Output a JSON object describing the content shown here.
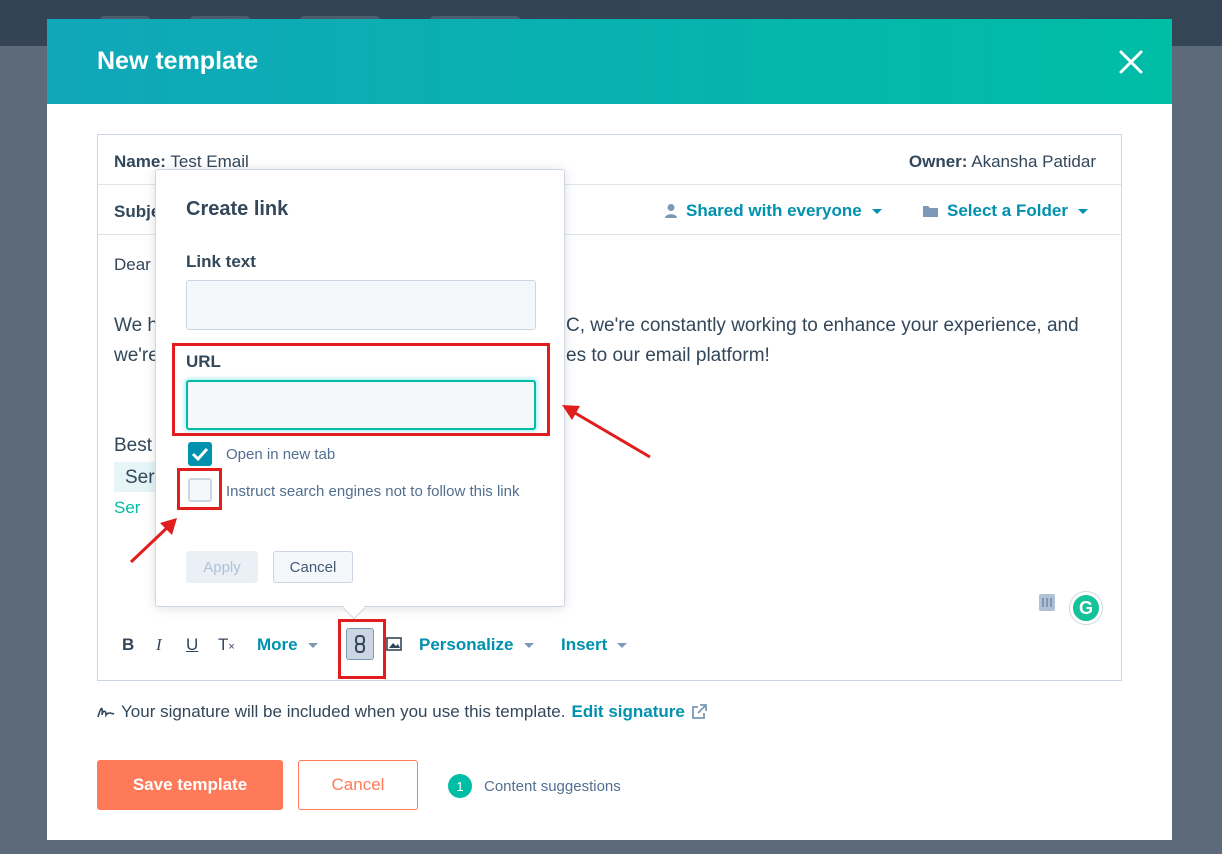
{
  "modal": {
    "title": "New template"
  },
  "template": {
    "name_label": "Name:",
    "name_value": "Test Email",
    "owner_label": "Owner:",
    "owner_value": "Akansha Patidar",
    "subject_label": "Subje",
    "shared_label": "Shared with everyone",
    "folder_label": "Select a Folder"
  },
  "body": {
    "line1": "Dear",
    "line2_prefix": "We h",
    "line2_suffix": "C, we're constantly working to enhance your experience, and",
    "line3_prefix": "we're",
    "line3_suffix": "es to our email platform!",
    "closing": "Best",
    "sig_line1": "Ser",
    "sig_line2": "Ser"
  },
  "toolbar": {
    "bold": "B",
    "italic": "I",
    "underline": "U",
    "clear": "T",
    "more": "More",
    "personalize": "Personalize",
    "insert": "Insert"
  },
  "signature_note": {
    "text": "Your signature will be included when you use this template.",
    "edit_label": "Edit signature"
  },
  "footer": {
    "save_label": "Save template",
    "cancel_label": "Cancel",
    "suggestion_count": "1",
    "suggestion_label": "Content suggestions"
  },
  "create_link": {
    "title": "Create link",
    "link_text_label": "Link text",
    "link_text_value": "",
    "url_label": "URL",
    "url_value": "",
    "open_new_tab_label": "Open in new tab",
    "open_new_tab_checked": true,
    "nofollow_label": "Instruct search engines not to follow this link",
    "nofollow_checked": false,
    "apply_label": "Apply",
    "cancel_label": "Cancel"
  },
  "colors": {
    "header_start": "#10a7b9",
    "header_end": "#00bda5",
    "link_blue": "#0091ae",
    "primary_orange": "#ff7a59",
    "annotation_red": "#e11d1d"
  }
}
